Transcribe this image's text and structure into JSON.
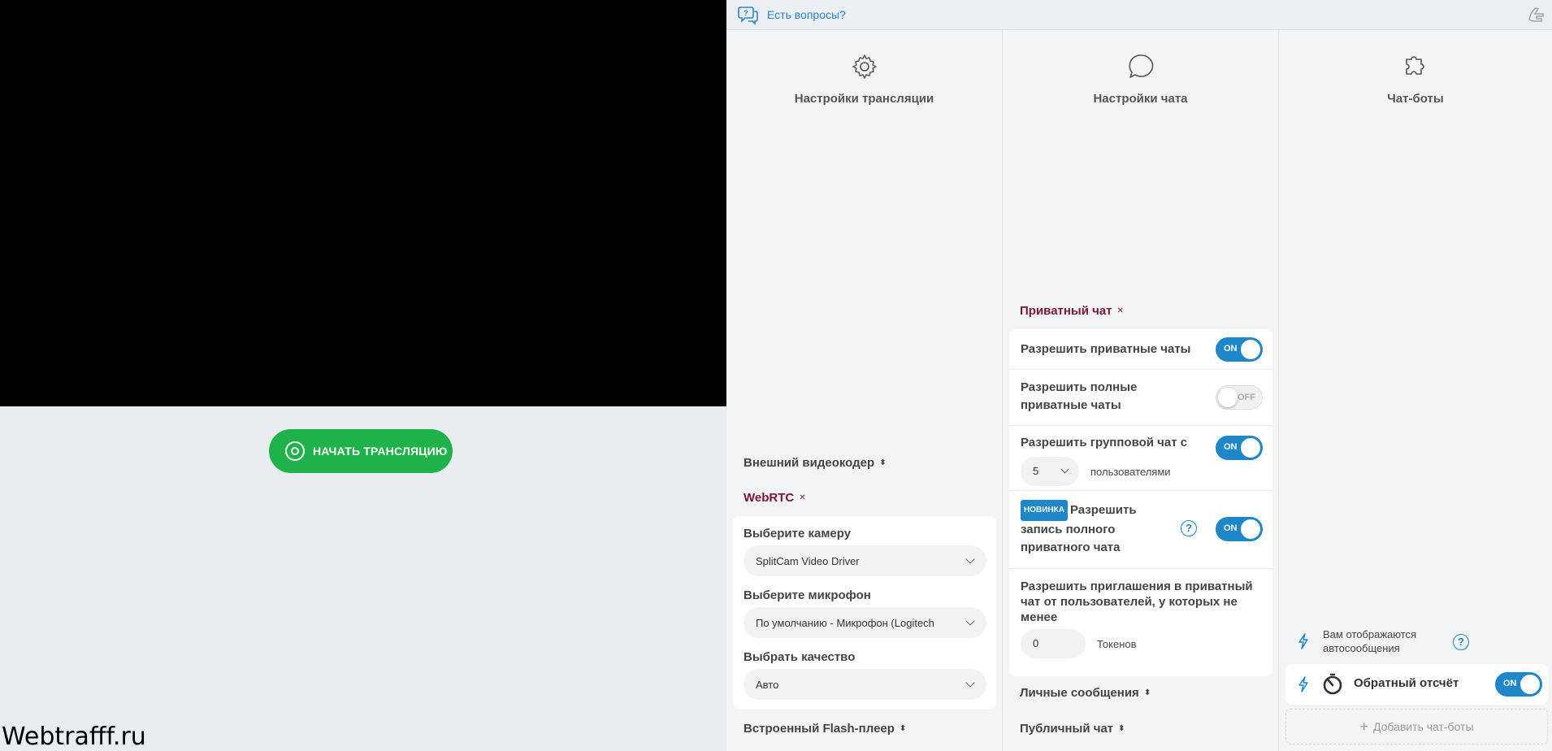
{
  "left": {
    "start_button": "НАЧАТЬ ТРАНСЛЯЦИЮ",
    "watermark": "Webtrafff.ru"
  },
  "topbar": {
    "help_text": "Есть вопросы?"
  },
  "broadcast": {
    "title": "Настройки трансляции",
    "encoder_section": "Внешний видеокодер",
    "webrtc_section": "WebRTC",
    "camera_label": "Выберите камеру",
    "camera_value": "SplitCam Video Driver",
    "mic_label": "Выберите микрофон",
    "mic_value": "По умолчанию - Микрофон (Logitech",
    "quality_label": "Выбрать качество",
    "quality_value": "Авто",
    "flash_section": "Встроенный Flash-плеер"
  },
  "chat": {
    "title": "Настройки чата",
    "private_section": "Приватный чат",
    "allow_private": "Разрешить приватные чаты",
    "allow_private_toggle": "ON",
    "allow_full_private_1": "Разрешить полные",
    "allow_full_private_2": "приватные чаты",
    "allow_full_private_toggle": "OFF",
    "group_chat": "Разрешить групповой чат с",
    "group_chat_count": "5",
    "group_chat_suffix": "пользователями",
    "group_chat_toggle": "ON",
    "new_badge": "НОВИНКА",
    "record_1": "Разрешить",
    "record_2": "запись полного",
    "record_3": "приватного чата",
    "record_toggle": "ON",
    "invites_1": "Разрешить приглашения в приватный",
    "invites_2": "чат от пользователей, у которых не",
    "invites_3": "менее",
    "invites_tokens_value": "0",
    "invites_tokens_label": "Токенов",
    "personal_section": "Личные сообщения",
    "public_section": "Публичный чат"
  },
  "bots": {
    "title": "Чат-боты",
    "auto_1": "Вам отображаются",
    "auto_2": "автосообщения",
    "countdown": "Обратный отсчёт",
    "countdown_toggle": "ON",
    "add": "Добавить чат-боты"
  },
  "colors": {
    "accent_blue": "#1f86c8",
    "start_green": "#1fb14a",
    "active_section": "#7d1436"
  }
}
